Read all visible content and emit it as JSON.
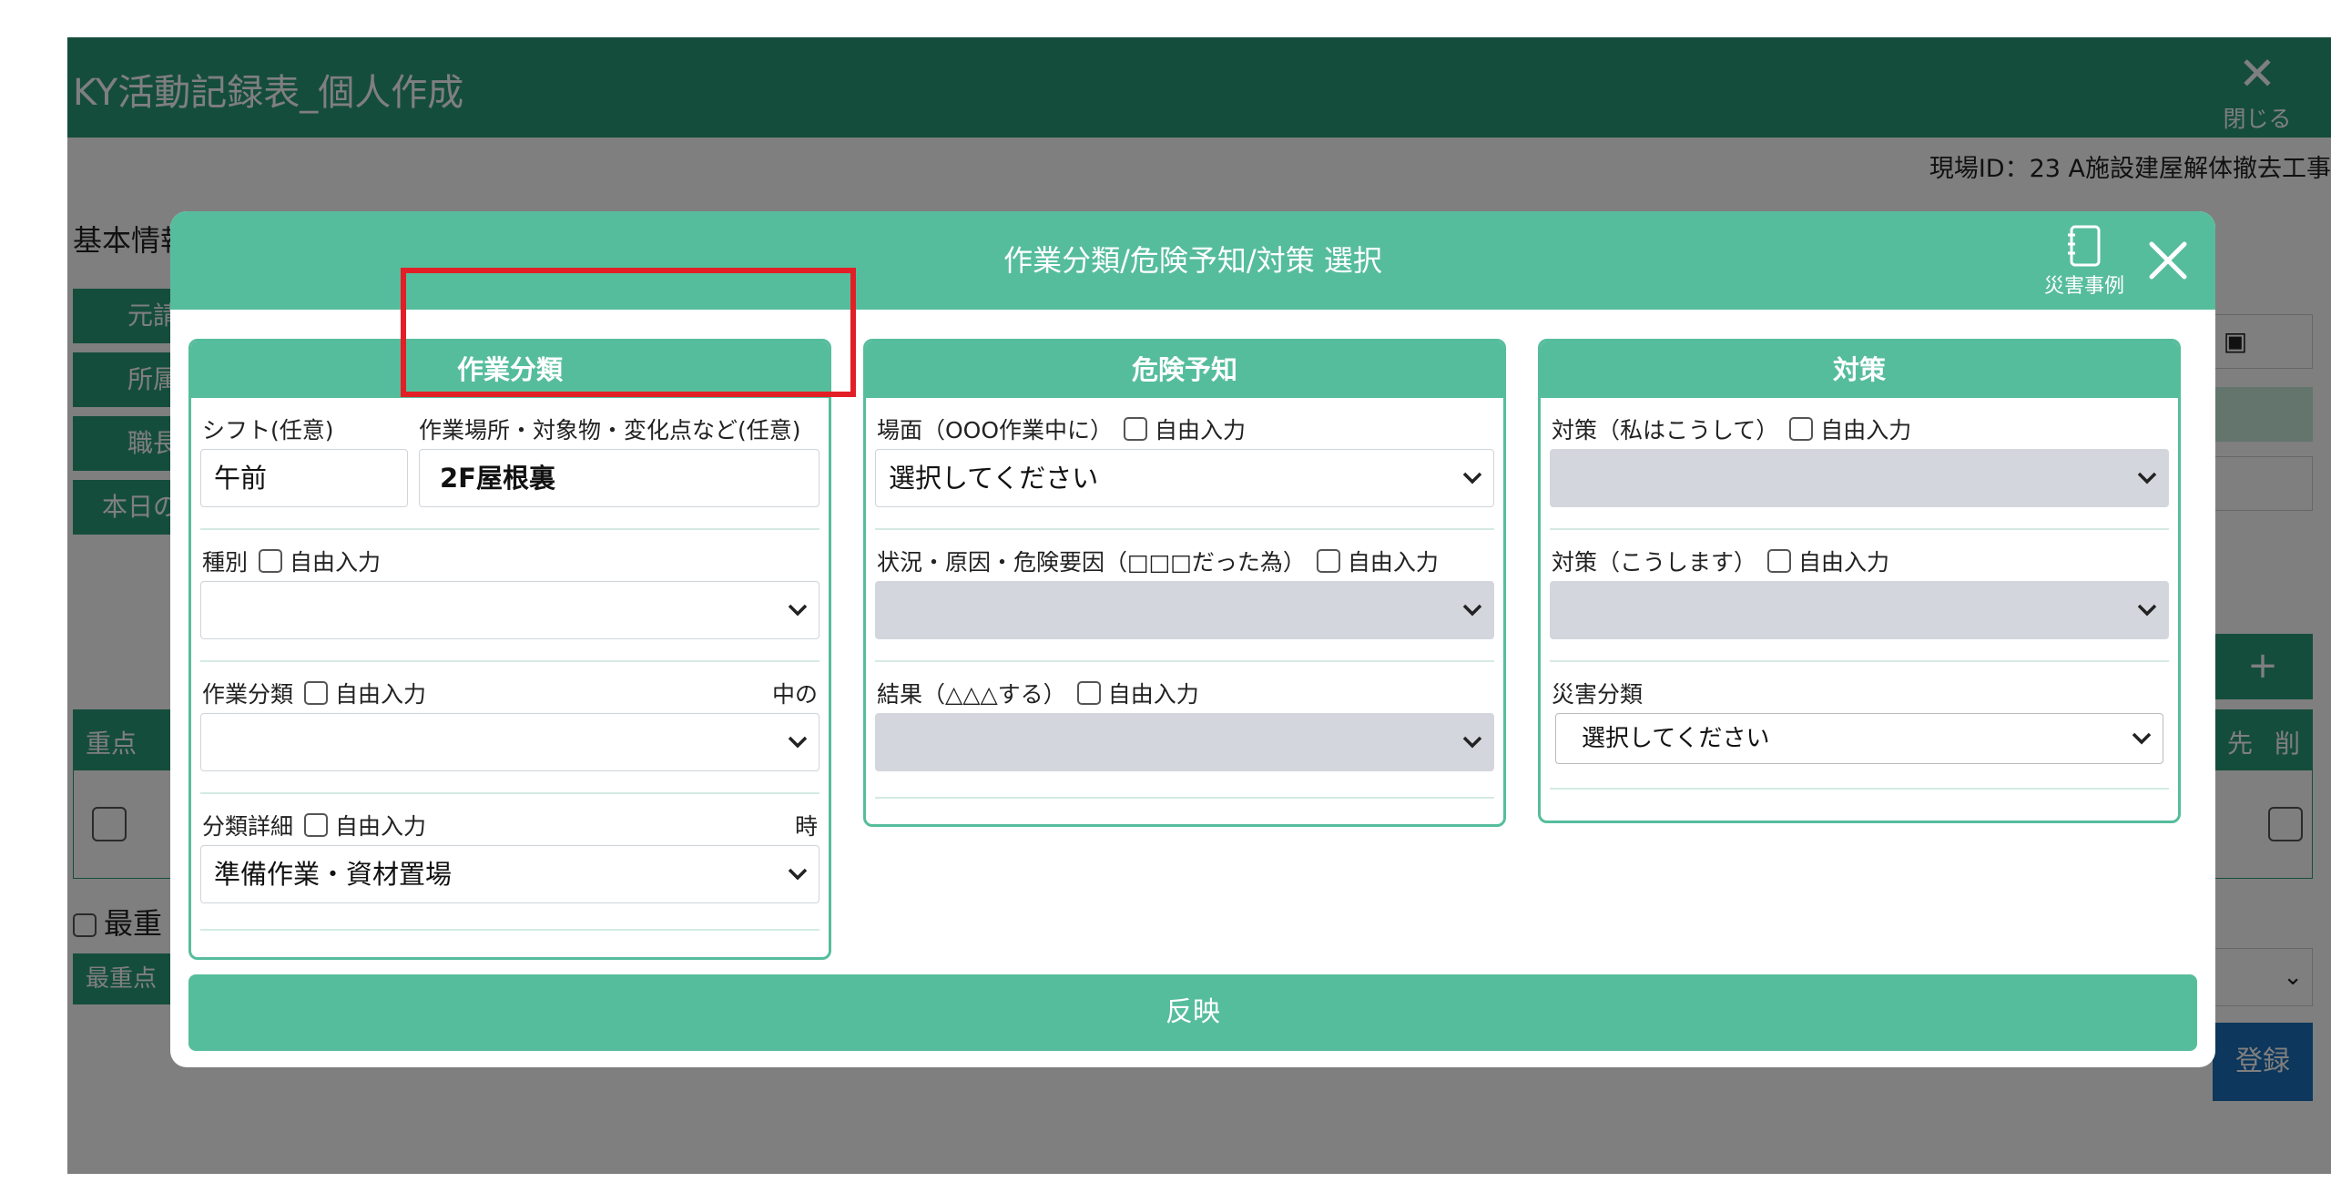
{
  "app": {
    "title": "KY活動記録表_個人作成",
    "close_label": "閉じる",
    "site_id": "現場ID：23 A施設建屋解体撤去工事",
    "basic_info_label": "基本情報",
    "side_buttons": [
      "元請",
      "所属",
      "職長",
      "本日の"
    ],
    "table_headers": [
      "重点",
      "先",
      "削"
    ],
    "most_important_checkbox_label": "最重",
    "most_important_button": "最重点",
    "register_button": "登録",
    "plus_button": "+"
  },
  "modal": {
    "title": "作業分類/危険予知/対策 選択",
    "disaster_cases_label": "災害事例",
    "reflect_button": "反映",
    "panels": {
      "work": {
        "header": "作業分類",
        "shift_label": "シフト(任意)",
        "shift_value": "午前",
        "location_label": "作業場所・対象物・変化点など(任意)",
        "location_value": "2F屋根裏",
        "type_label": "種別",
        "type_free_input": "自由入力",
        "type_value": "",
        "category_label": "作業分類",
        "category_free_input": "自由入力",
        "category_right": "中の",
        "category_value": "",
        "detail_label": "分類詳細",
        "detail_free_input": "自由入力",
        "detail_right": "時",
        "detail_value": "準備作業・資材置場"
      },
      "hazard": {
        "header": "危険予知",
        "scene_label": "場面（OOO作業中に）",
        "scene_free_input": "自由入力",
        "scene_value": "選択してください",
        "situation_label": "状況・原因・危険要因（□□□だった為）",
        "situation_free_input": "自由入力",
        "situation_value": "",
        "result_label": "結果（△△△する）",
        "result_free_input": "自由入力",
        "result_value": ""
      },
      "measure": {
        "header": "対策",
        "self_label": "対策（私はこうして）",
        "self_free_input": "自由入力",
        "self_value": "",
        "plan_label": "対策（こうします）",
        "plan_free_input": "自由入力",
        "plan_value": "",
        "disaster_type_label": "災害分類",
        "disaster_type_value": "選択してください"
      }
    }
  },
  "colors": {
    "app_green": "#2a9b78",
    "modal_green": "#56bd9c",
    "highlight_red": "#e21f26",
    "register_blue": "#1a6fb8"
  }
}
